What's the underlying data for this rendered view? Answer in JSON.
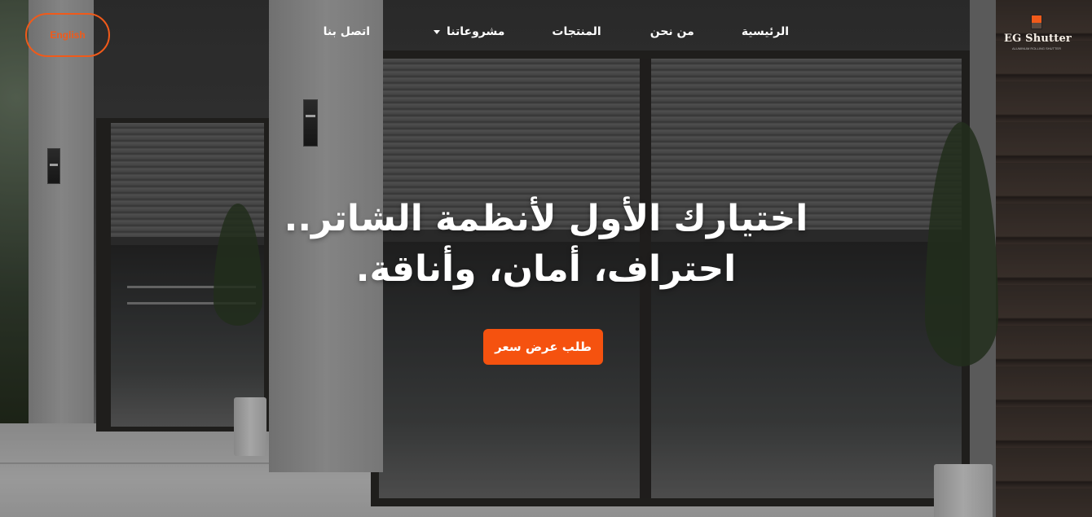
{
  "brand": {
    "name": "EG Shutter",
    "tagline": "ALUMINUM ROLLING SHUTTER",
    "accent_color": "#f5520f"
  },
  "header": {
    "language_button": "English",
    "nav": {
      "home": "الرئيسية",
      "about": "من نحن",
      "products": "المنتجات",
      "projects": "مشروعاتنا",
      "contact": "اتصل بنا"
    },
    "icons": {
      "projects_dropdown": "chevron-down-icon"
    }
  },
  "hero": {
    "title_line1": "اختيارك الأول لأنظمة الشاتر..",
    "title_line2": "احتراف، أمان، وأناقة.",
    "cta_label": "طلب عرض سعر"
  }
}
